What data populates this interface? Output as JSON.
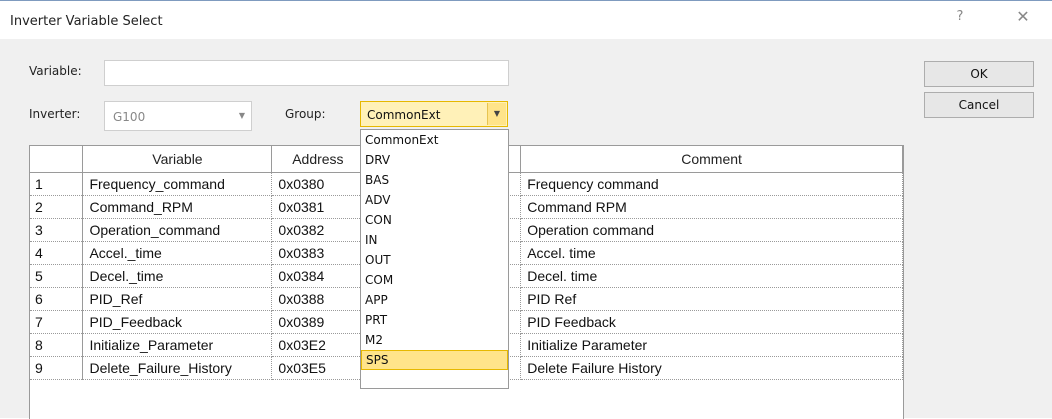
{
  "window": {
    "title": "Inverter Variable Select",
    "help_label": "?",
    "close_label": "✕"
  },
  "form": {
    "variable_label": "Variable:",
    "variable_value": "",
    "inverter_label": "Inverter:",
    "inverter_value": "G100",
    "group_label": "Group:",
    "group_value": "CommonExt"
  },
  "buttons": {
    "ok": "OK",
    "cancel": "Cancel"
  },
  "table": {
    "headers": [
      "",
      "Variable",
      "Address",
      "",
      "Comment"
    ],
    "rows": [
      {
        "num": "1",
        "variable": "Frequency_command",
        "address": "0x0380",
        "comment": "Frequency command"
      },
      {
        "num": "2",
        "variable": "Command_RPM",
        "address": "0x0381",
        "comment": "Command RPM"
      },
      {
        "num": "3",
        "variable": "Operation_command",
        "address": "0x0382",
        "comment": "Operation command"
      },
      {
        "num": "4",
        "variable": "Accel._time",
        "address": "0x0383",
        "comment": "Accel. time"
      },
      {
        "num": "5",
        "variable": "Decel._time",
        "address": "0x0384",
        "comment": "Decel. time"
      },
      {
        "num": "6",
        "variable": "PID_Ref",
        "address": "0x0388",
        "comment": "PID Ref"
      },
      {
        "num": "7",
        "variable": "PID_Feedback",
        "address": "0x0389",
        "comment": "PID Feedback"
      },
      {
        "num": "8",
        "variable": "Initialize_Parameter",
        "address": "0x03E2",
        "comment": "Initialize Parameter"
      },
      {
        "num": "9",
        "variable": "Delete_Failure_History",
        "address": "0x03E5",
        "comment": "Delete Failure History"
      }
    ]
  },
  "dropdown": {
    "options": [
      "CommonExt",
      "DRV",
      "BAS",
      "ADV",
      "CON",
      "IN",
      "OUT",
      "COM",
      "APP",
      "PRT",
      "M2",
      "SPS"
    ],
    "highlighted": "SPS"
  },
  "colors": {
    "highlight": "#ffe48a",
    "highlight_border": "#e6b800",
    "dialog_bg": "#f0f0f0"
  }
}
